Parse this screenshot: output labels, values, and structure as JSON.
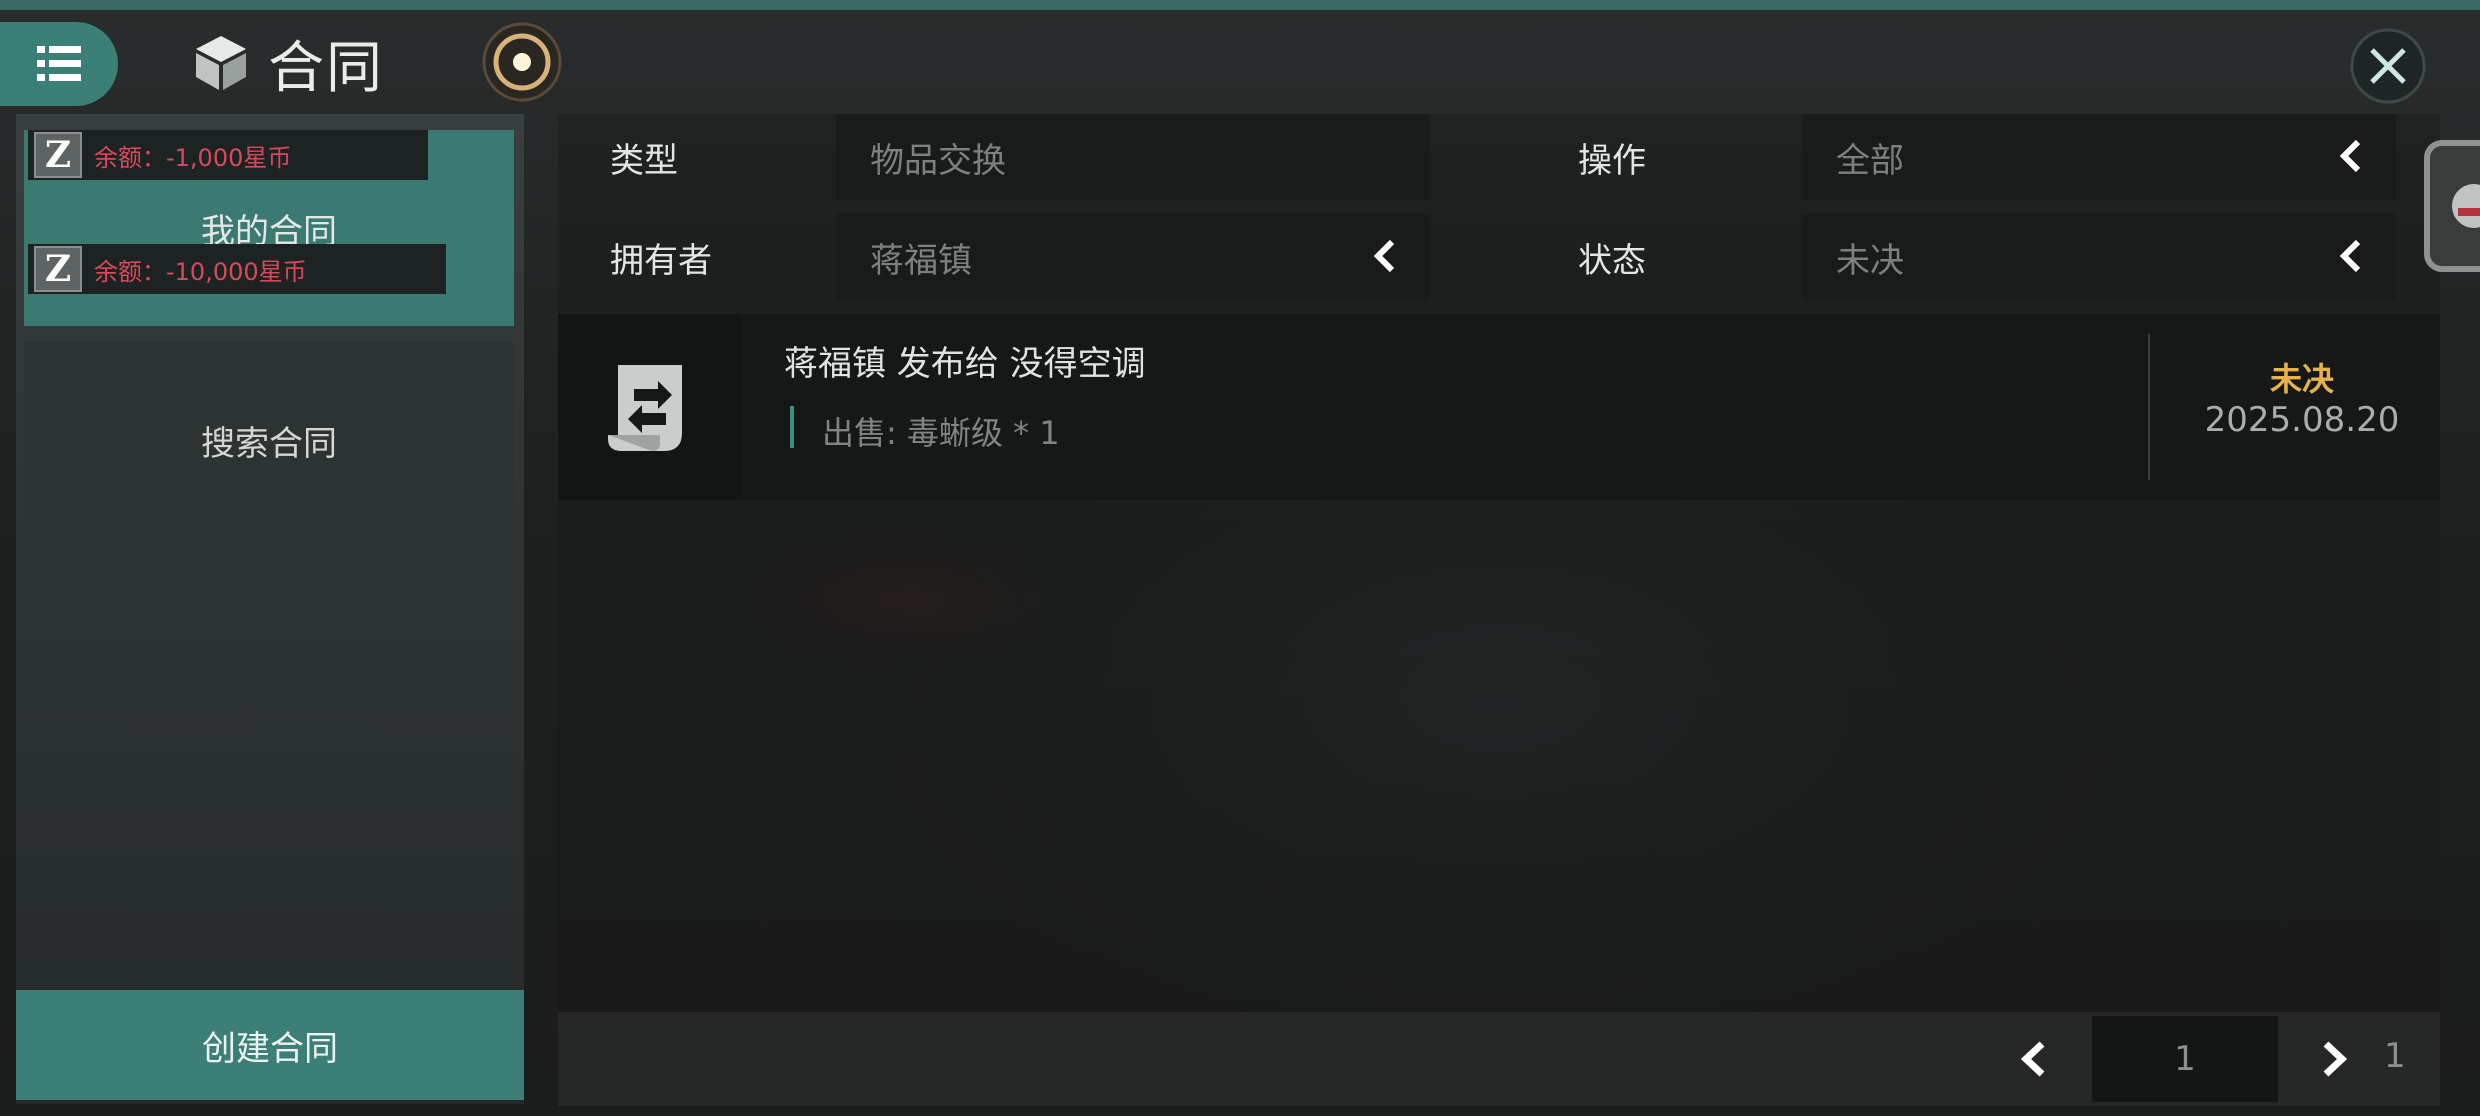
{
  "header": {
    "title": "合同",
    "icons": {
      "menu": "menu-icon",
      "title": "cube-icon",
      "orb": "orb-icon",
      "close": "close-icon"
    }
  },
  "sidebar": {
    "tabs": [
      {
        "label": "我的合同",
        "active": true
      },
      {
        "label": "搜索合同",
        "active": false
      }
    ],
    "balances": [
      {
        "badge": "Z",
        "text": "余额：-1,000星币"
      },
      {
        "badge": "Z",
        "text": "余额：-10,000星币"
      }
    ],
    "create_label": "创建合同"
  },
  "filters": {
    "type": {
      "label": "类型",
      "value": "物品交换"
    },
    "operation": {
      "label": "操作",
      "value": "全部"
    },
    "owner": {
      "label": "拥有者",
      "value": "蒋福镇"
    },
    "status": {
      "label": "状态",
      "value": "未决"
    }
  },
  "contracts": [
    {
      "title": "蒋福镇 发布给 没得空调",
      "detail": "出售: 毒蜥级 * 1",
      "status": "未决",
      "date": "2025.08.20",
      "icon": "contract-scroll-icon"
    }
  ],
  "pagination": {
    "current": "1",
    "total": "1"
  },
  "colors": {
    "accent": "#3b7f76",
    "balance_negative": "#d84a5b",
    "status_pending": "#e6b04c"
  }
}
